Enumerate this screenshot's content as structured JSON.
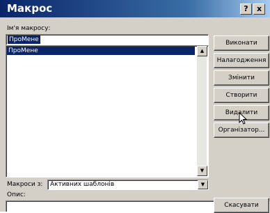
{
  "window": {
    "title": "Макрос",
    "help_label": "?",
    "close_label": "x"
  },
  "macro_name": {
    "label": "Ім'я макросу:",
    "value": "ПроМене"
  },
  "macro_list": {
    "items": [
      "ПроМене"
    ],
    "selected_index": 0
  },
  "macros_in": {
    "label": "Макроси з:",
    "value": "Активних шаблонів"
  },
  "description": {
    "label": "Опис:",
    "value": ""
  },
  "buttons": {
    "run": "Виконати",
    "step_into": "Налагодження",
    "edit": "Змінити",
    "create": "Створити",
    "delete": "Видалити",
    "organizer": "Організатор...",
    "cancel": "Скасувати"
  }
}
